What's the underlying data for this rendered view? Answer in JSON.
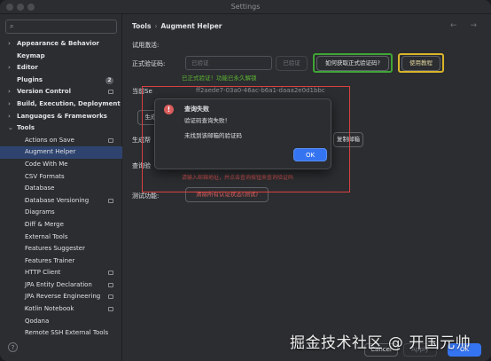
{
  "window": {
    "title": "Settings"
  },
  "sidebar": {
    "search_placeholder": "",
    "items": [
      {
        "label": "Appearance & Behavior",
        "arrow": "›",
        "bold": true,
        "indent": 0
      },
      {
        "label": "Keymap",
        "arrow": "",
        "bold": true,
        "indent": 0
      },
      {
        "label": "Editor",
        "arrow": "›",
        "bold": true,
        "indent": 0
      },
      {
        "label": "Plugins",
        "arrow": "",
        "bold": true,
        "indent": 0,
        "count": "2"
      },
      {
        "label": "Version Control",
        "arrow": "›",
        "bold": true,
        "indent": 0,
        "badge": true
      },
      {
        "label": "Build, Execution, Deployment",
        "arrow": "›",
        "bold": true,
        "indent": 0
      },
      {
        "label": "Languages & Frameworks",
        "arrow": "›",
        "bold": true,
        "indent": 0
      },
      {
        "label": "Tools",
        "arrow": "⌄",
        "bold": true,
        "indent": 0
      },
      {
        "label": "Actions on Save",
        "arrow": "",
        "bold": false,
        "indent": 1,
        "badge": true
      },
      {
        "label": "Augment Helper",
        "arrow": "",
        "bold": false,
        "indent": 1,
        "selected": true
      },
      {
        "label": "Code With Me",
        "arrow": "",
        "bold": false,
        "indent": 1
      },
      {
        "label": "CSV Formats",
        "arrow": "",
        "bold": false,
        "indent": 1
      },
      {
        "label": "Database",
        "arrow": "›",
        "bold": false,
        "indent": 1
      },
      {
        "label": "Database Versioning",
        "arrow": "›",
        "bold": false,
        "indent": 1,
        "badge": true
      },
      {
        "label": "Diagrams",
        "arrow": "",
        "bold": false,
        "indent": 1
      },
      {
        "label": "Diff & Merge",
        "arrow": "›",
        "bold": false,
        "indent": 1
      },
      {
        "label": "External Tools",
        "arrow": "",
        "bold": false,
        "indent": 1
      },
      {
        "label": "Features Suggester",
        "arrow": "",
        "bold": false,
        "indent": 1
      },
      {
        "label": "Features Trainer",
        "arrow": "",
        "bold": false,
        "indent": 1
      },
      {
        "label": "HTTP Client",
        "arrow": "",
        "bold": false,
        "indent": 1,
        "badge": true
      },
      {
        "label": "JPA Entity Declaration",
        "arrow": "",
        "bold": false,
        "indent": 1,
        "badge": true
      },
      {
        "label": "JPA Reverse Engineering",
        "arrow": "",
        "bold": false,
        "indent": 1,
        "badge": true
      },
      {
        "label": "Kotlin Notebook",
        "arrow": "›",
        "bold": false,
        "indent": 1,
        "badge": true
      },
      {
        "label": "Qodana",
        "arrow": "",
        "bold": false,
        "indent": 1
      },
      {
        "label": "Remote SSH External Tools",
        "arrow": "",
        "bold": false,
        "indent": 1
      }
    ],
    "help": "?"
  },
  "main": {
    "breadcrumb": {
      "parent": "Tools",
      "sep": "›",
      "current": "Augment Helper"
    },
    "nav": "← →",
    "section_title": "试用激活:",
    "code_label": "正式验证码:",
    "code_placeholder": "已验证",
    "verified_button": "已验证",
    "how_button": "如何获取正式验证码?",
    "tutorial_button": "使用教程",
    "verified_note": "已正式验证！功能已永久解锁",
    "current_label": "当前Se",
    "current_value": "ff2aede7-03a0-46ac-b6a1-daaa2e0d1bbc",
    "gen_button": "生成",
    "gen_label": "生成帮",
    "copy_button": "复制邮箱",
    "query_label": "查询验",
    "red_hint": "请输入邮箱地址，并点击查询按钮来查询验证码",
    "test_label": "测试功能:",
    "clear_button": "清除所有认证状态(测试)"
  },
  "dialog": {
    "icon": "!",
    "title": "查询失败",
    "message1": "验证码查询失败！",
    "message2": "未找到该邮箱的验证码",
    "ok": "OK"
  },
  "footer": {
    "cancel": "Cancel",
    "apply": "Apply",
    "ok": "OK"
  },
  "watermark": "掘金技术社区 @ 开国元帅",
  "colors": {
    "accent": "#3574f0",
    "green": "#5fb834",
    "red": "#d9403f",
    "yellow": "#d8b42a",
    "error_icon": "#db5c5c"
  }
}
